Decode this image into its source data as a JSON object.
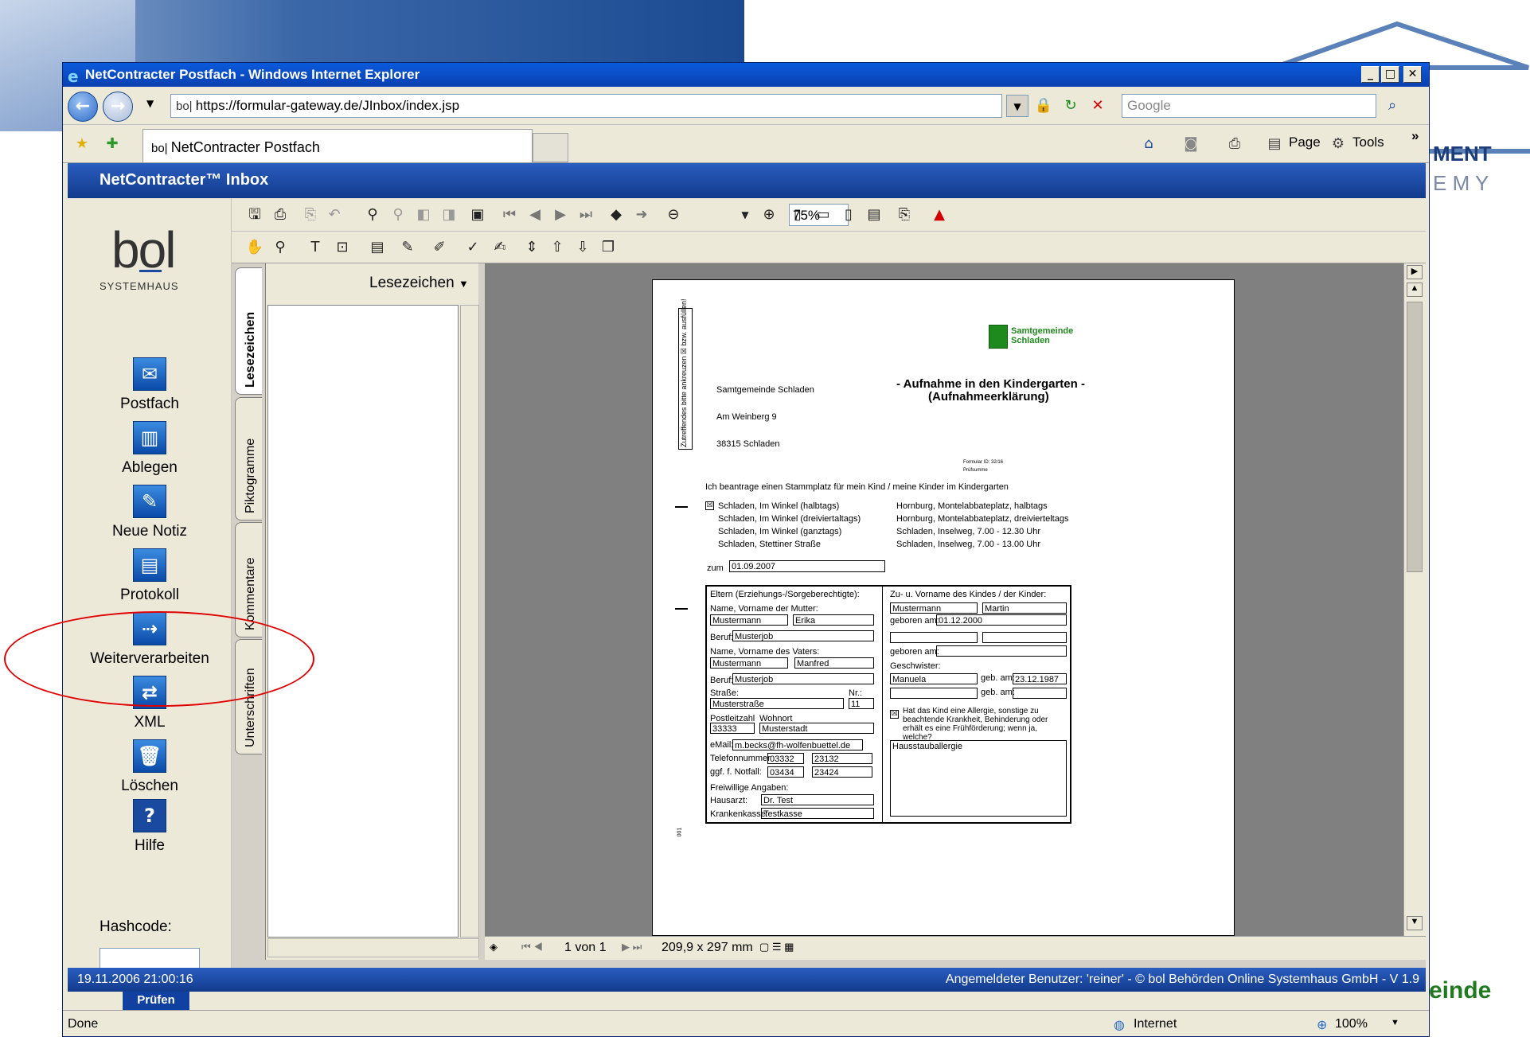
{
  "browser": {
    "title": "NetContracter Postfach - Windows Internet Explorer",
    "address": "https://formular-gateway.de/JInbox/index.jsp",
    "search_placeholder": "Google",
    "tab_label": "NetContracter Postfach",
    "page_menu": "Page",
    "tools_menu": "Tools",
    "status_done": "Done",
    "zone": "Internet",
    "zoom": "100%"
  },
  "background": {
    "right_text_1": "MENT",
    "right_text_2": "E M Y",
    "bottom_right": "einde"
  },
  "app": {
    "header": "NetContracter™ Inbox",
    "logo": "bol",
    "logo_sub": "SYSTEMHAUS",
    "timestamp": "19.11.2006 21:00:16",
    "user_info": "Angemeldeter Benutzer: 'reiner' - © bol Behörden Online Systemhaus GmbH  - V 1.9"
  },
  "sidebar": {
    "items": [
      {
        "label": "Postfach",
        "icon": "inbox-icon"
      },
      {
        "label": "Ablegen",
        "icon": "file-icon"
      },
      {
        "label": "Neue Notiz",
        "icon": "note-icon"
      },
      {
        "label": "Protokoll",
        "icon": "log-icon"
      },
      {
        "label": "Weiterverarbeiten",
        "icon": "forward-icon"
      },
      {
        "label": "XML",
        "icon": "xml-icon"
      },
      {
        "label": "Löschen",
        "icon": "trash-icon"
      },
      {
        "label": "Hilfe",
        "icon": "help-icon"
      }
    ],
    "hash_label": "Hashcode:",
    "check_button": "Prüfen"
  },
  "reader": {
    "zoom": "75%",
    "bookmarks_title": "Lesezeichen",
    "side_tabs": [
      "Lesezeichen",
      "Piktogramme",
      "Kommentare",
      "Unterschriften"
    ],
    "page_info": "1 von 1",
    "page_size": "209,9 x 297 mm"
  },
  "doc": {
    "logo_line1": "Samtgemeinde",
    "logo_line2": "Schladen",
    "vertical_note": "Zutreffendes bitte ankreuzen ☒ bzw. ausfüllen!",
    "addr1": "Samtgemeinde Schladen",
    "addr2": "Am Weinberg 9",
    "addr3": "38315 Schladen",
    "title1": "- Aufnahme in den Kindergarten -",
    "title2": "(Aufnahmeerklärung)",
    "form_id": "Formular ID:    32/16",
    "test": "Prüfsumme",
    "intro": "Ich beantrage einen Stammplatz für mein Kind / meine Kinder im Kindergarten",
    "opts_left": [
      "Schladen, Im Winkel (halbtags)",
      "Schladen, Im Winkel (dreiviertaltags)",
      "Schladen, Im Winkel (ganztags)",
      "Schladen, Stettiner Straße"
    ],
    "opts_right": [
      "Hornburg, Montelabbateplatz, halbtags",
      "Hornburg, Montelabbateplatz, dreivierteltags",
      "Schladen, Inselweg, 7.00 - 12.30 Uhr",
      "Schladen, Inselweg, 7.00 - 13.00 Uhr"
    ],
    "zum": "zum",
    "date": "01.09.2007",
    "parents_title": "Eltern (Erziehungs-/Sorgeberechtigte):",
    "mother_label": "Name, Vorname der Mutter:",
    "mother_last": "Mustermann",
    "mother_first": "Erika",
    "beruf": "Beruf:",
    "mother_job": "Musterjob",
    "father_label": "Name, Vorname des Vaters:",
    "father_last": "Mustermann",
    "father_first": "Manfred",
    "father_job": "Musterjob",
    "street_label": "Straße:",
    "nr_label": "Nr.:",
    "street": "Musterstraße",
    "nr": "11",
    "plz_label": "Postleitzahl",
    "ort_label": "Wohnort",
    "plz": "33333",
    "ort": "Musterstadt",
    "email_label": "eMail:",
    "email": "m.becks@fh-wolfenbuettel.de",
    "tel_label": "Telefonnummer",
    "tel1": "03332",
    "tel2": "23132",
    "notfall_label": "ggf. f. Notfall:",
    "not1": "03434",
    "not2": "23424",
    "freiw": "Freiwillige Angaben:",
    "arzt_label": "Hausarzt:",
    "arzt": "Dr. Test",
    "kasse_label": "Krankenkasse:",
    "kasse": "Testkasse",
    "child_title": "Zu- u. Vorname des Kindes / der Kinder:",
    "child_last": "Mustermann",
    "child_first": "Martin",
    "geb_label": "geboren am:",
    "child_dob": "01.12.2000",
    "geschwister": "Geschwister:",
    "sib_name": "Manuela",
    "gebam": "geb. am:",
    "sib_dob": "23.12.1987",
    "allergy_q": "Hat das Kind eine Allergie, sonstige zu beachtende Krankheit, Behinderung oder erhält es eine Frühförderung; wenn ja, welche?",
    "allergy": "Hausstauballergie",
    "footer_code": "001"
  }
}
